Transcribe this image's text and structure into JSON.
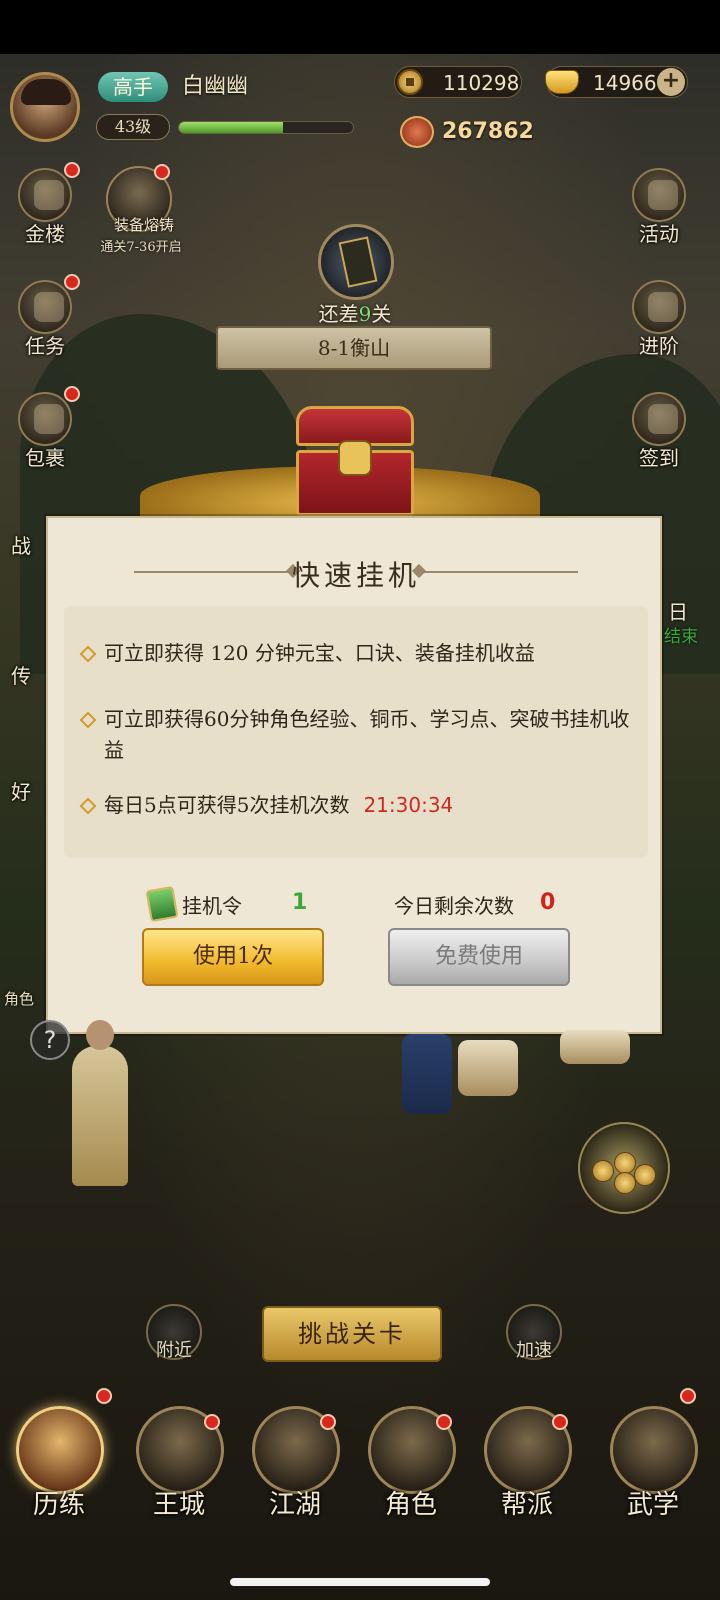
{
  "header": {
    "rank": "高手",
    "player_name": "白幽幽",
    "level": "43级",
    "exp_fraction": 0.6,
    "copper": "110298",
    "gold": "14966",
    "power": "267862"
  },
  "left_menu": {
    "gold_tower": "金楼",
    "quest": "任务",
    "bag": "包裹",
    "battle_partial": "战",
    "legend_partial": "传",
    "friend_partial": "好",
    "role_partial": "角色"
  },
  "right_menu": {
    "event": "活动",
    "advance": "进阶",
    "sign_in": "签到",
    "daily_partial": "日",
    "end_partial": "结束"
  },
  "equip": {
    "title": "装备熔铸",
    "unlock": "通关7-36开启"
  },
  "stage": {
    "remain_prefix": "还差",
    "remain_num": "9",
    "remain_suffix": "关",
    "name": "8-1衡山"
  },
  "dialog": {
    "title": "快速挂机",
    "bullet1": "可立即获得 120 分钟元宝、口诀、装备挂机收益",
    "bullet2": "可立即获得60分钟角色经验、铜币、学习点、突破书挂机收益",
    "bullet3": "每日5点可获得5次挂机次数",
    "timer": "21:30:34",
    "token_label": "挂机令",
    "token_count": "1",
    "remain_label": "今日剩余次数",
    "remain_count": "0",
    "use_button": "使用1次",
    "free_button": "免费使用"
  },
  "bottom": {
    "nearby": "附近",
    "accelerate": "加速",
    "challenge": "挑战关卡",
    "hint": "?"
  },
  "nav": [
    {
      "label": "历练",
      "active": true
    },
    {
      "label": "王城",
      "active": false
    },
    {
      "label": "江湖",
      "active": false
    },
    {
      "label": "角色",
      "active": false
    },
    {
      "label": "帮派",
      "active": false
    },
    {
      "label": "武学",
      "active": false
    }
  ],
  "colors": {
    "timer_red": "#cc2a20",
    "token_green": "#3ba83a",
    "use_button_gold": "#f1b92c",
    "free_button_gray": "#c9c9c9",
    "dialog_bg": "#efe7d6"
  }
}
